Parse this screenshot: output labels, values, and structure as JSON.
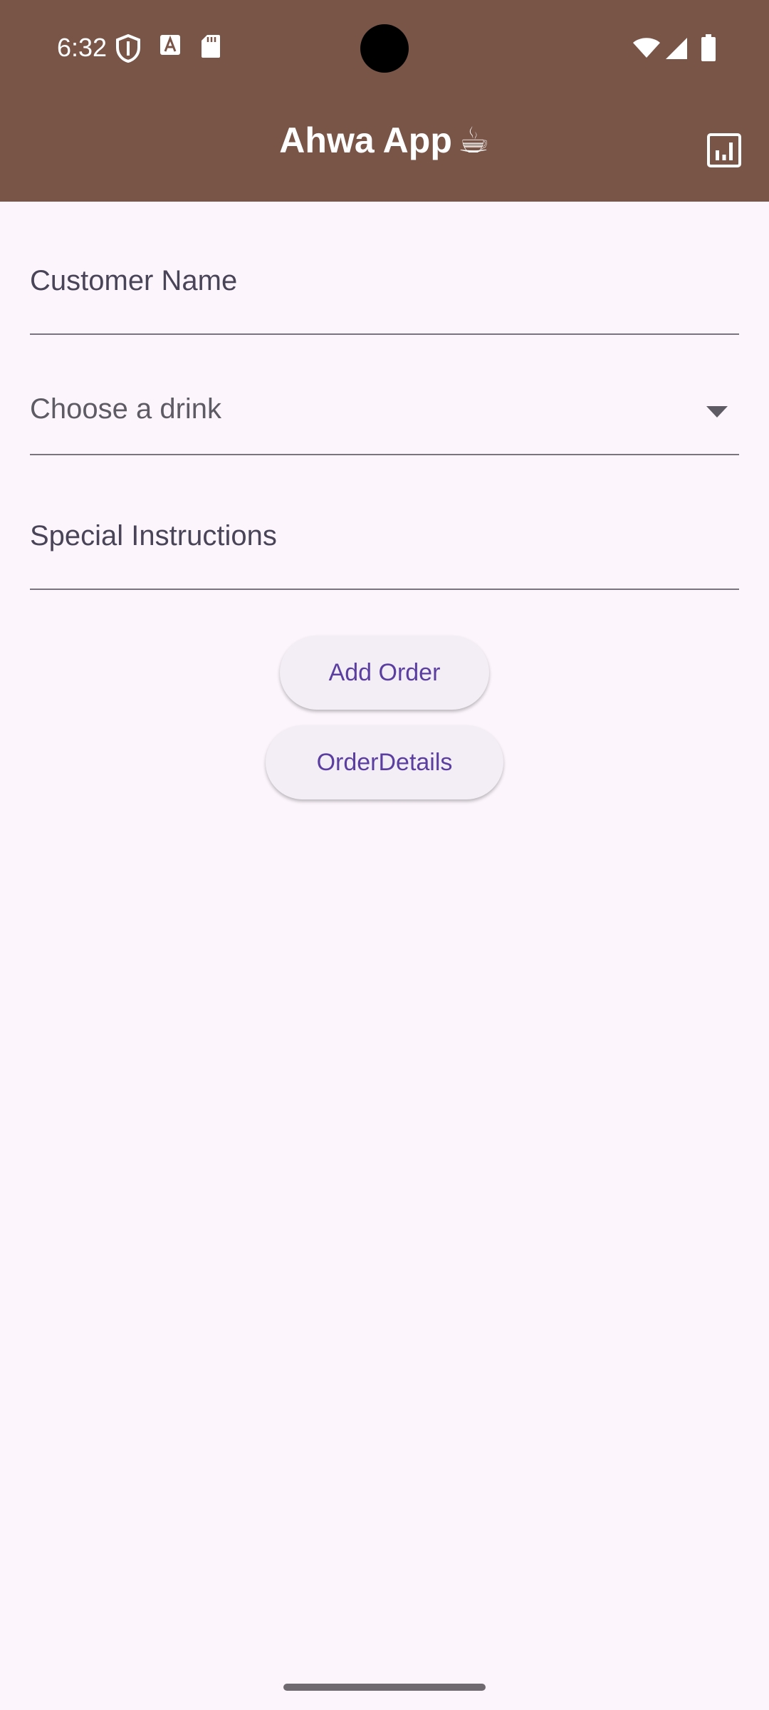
{
  "status_bar": {
    "time": "6:32",
    "left_icons": [
      "shield-icon",
      "font-download-icon",
      "sd-card-icon"
    ],
    "right_icons": [
      "wifi-icon",
      "signal-icon",
      "battery-icon"
    ]
  },
  "app_bar": {
    "title": "Ahwa App",
    "title_emoji": "☕",
    "action_icon": "bar-chart-icon",
    "background": "#795548"
  },
  "form": {
    "customer_name": {
      "label": "Customer Name",
      "value": ""
    },
    "drink_select": {
      "placeholder": "Choose a drink",
      "value": ""
    },
    "special_instructions": {
      "label": "Special Instructions",
      "value": ""
    }
  },
  "buttons": {
    "add_order": "Add Order",
    "order_details": "OrderDetails"
  },
  "colors": {
    "accent": "#5b3fa0",
    "background": "#fcf6fc"
  }
}
